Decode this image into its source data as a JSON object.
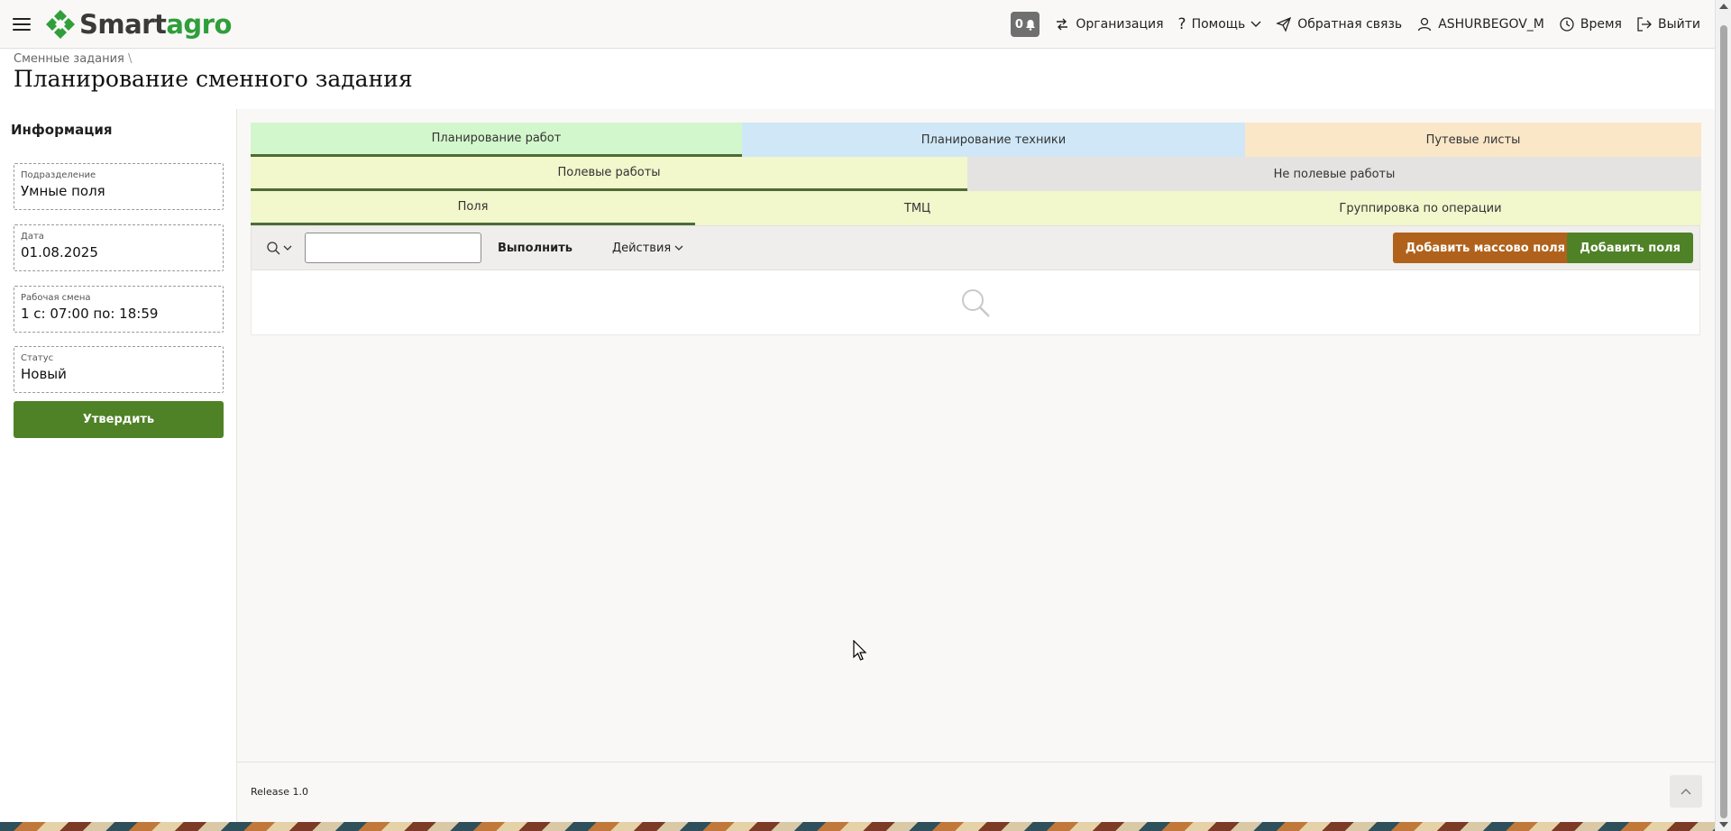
{
  "header": {
    "logo_part1": "Smart",
    "logo_part2": "agro",
    "notifications_count": "0",
    "organization": "Организация",
    "help": "Помощь",
    "feedback": "Обратная связь",
    "user": "ASHURBEGOV_M",
    "time": "Время",
    "logout": "Выйти"
  },
  "breadcrumb": "Сменные задания",
  "page_title": "Планирование сменного задания",
  "info_panel": {
    "title": "Информация",
    "fields": [
      {
        "label": "Подразделение",
        "value": "Умные поля"
      },
      {
        "label": "Дата",
        "value": "01.08.2025"
      },
      {
        "label": "Рабочая смена",
        "value": "1 с: 07:00 по: 18:59"
      },
      {
        "label": "Статус",
        "value": "Новый"
      }
    ],
    "approve_label": "Утвердить"
  },
  "tabs": {
    "row1": [
      {
        "label": "Планирование работ",
        "color": "#d3f7cc"
      },
      {
        "label": "Планирование техники",
        "color": "#cfe7f6"
      },
      {
        "label": "Путевые листы",
        "color": "#fae7c8"
      }
    ],
    "row2": [
      {
        "label": "Полевые работы",
        "color": "#f2f7cc"
      },
      {
        "label": "Не полевые работы",
        "color": "#e4e3e1"
      }
    ],
    "row3": [
      {
        "label": "Поля",
        "color": "#f2f7cc"
      },
      {
        "label": "ТМЦ",
        "color": "#f2f7cc"
      },
      {
        "label": "Группировка по операции",
        "color": "#f2f7cc"
      }
    ]
  },
  "toolbar": {
    "search_value": "",
    "execute_label": "Выполнить",
    "actions_label": "Действия",
    "add_mass_label": "Добавить массово поля",
    "add_label": "Добавить поля"
  },
  "footer": {
    "release": "Release 1.0"
  },
  "colors": {
    "brand_green": "#2f9e3b",
    "primary_button": "#4f8226",
    "secondary_button": "#b0621c"
  }
}
